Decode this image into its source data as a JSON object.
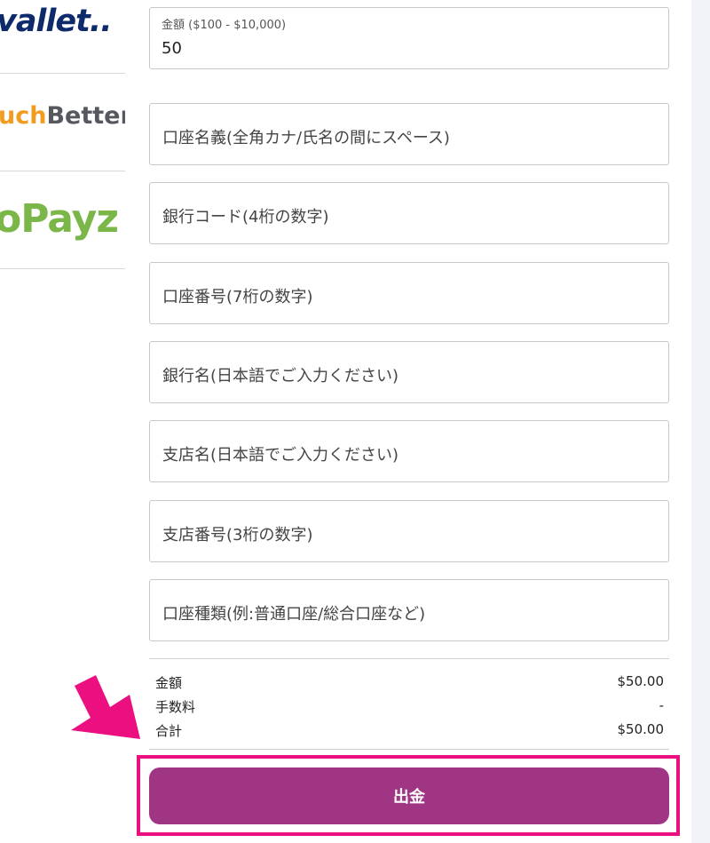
{
  "methods": [
    {
      "name": "ewallet",
      "logo_text": "vallet.."
    },
    {
      "name": "muchbetter",
      "logo_text_a": "uch",
      "logo_text_b": "Better"
    },
    {
      "name": "payz",
      "logo_text": "oPayz"
    }
  ],
  "form": {
    "amount": {
      "label": "金額 ($100 - $10,000)",
      "value": "50"
    },
    "account_holder": {
      "placeholder": "口座名義(全角カナ/氏名の間にスペース)"
    },
    "bank_code": {
      "placeholder": "銀行コード(4桁の数字)"
    },
    "account_number": {
      "placeholder": "口座番号(7桁の数字)"
    },
    "bank_name": {
      "placeholder": "銀行名(日本語でご入力ください)"
    },
    "branch_name": {
      "placeholder": "支店名(日本語でご入力ください)"
    },
    "branch_number": {
      "placeholder": "支店番号(3桁の数字)"
    },
    "account_type": {
      "placeholder": "口座種類(例:普通口座/総合口座など)"
    }
  },
  "summary": {
    "amount_label": "金額",
    "amount_value": "$50.00",
    "fee_label": "手数料",
    "fee_value": "-",
    "total_label": "合計",
    "total_value": "$50.00"
  },
  "submit_label": "出金",
  "colors": {
    "accent": "#a03584",
    "highlight": "#ec0f7f"
  }
}
